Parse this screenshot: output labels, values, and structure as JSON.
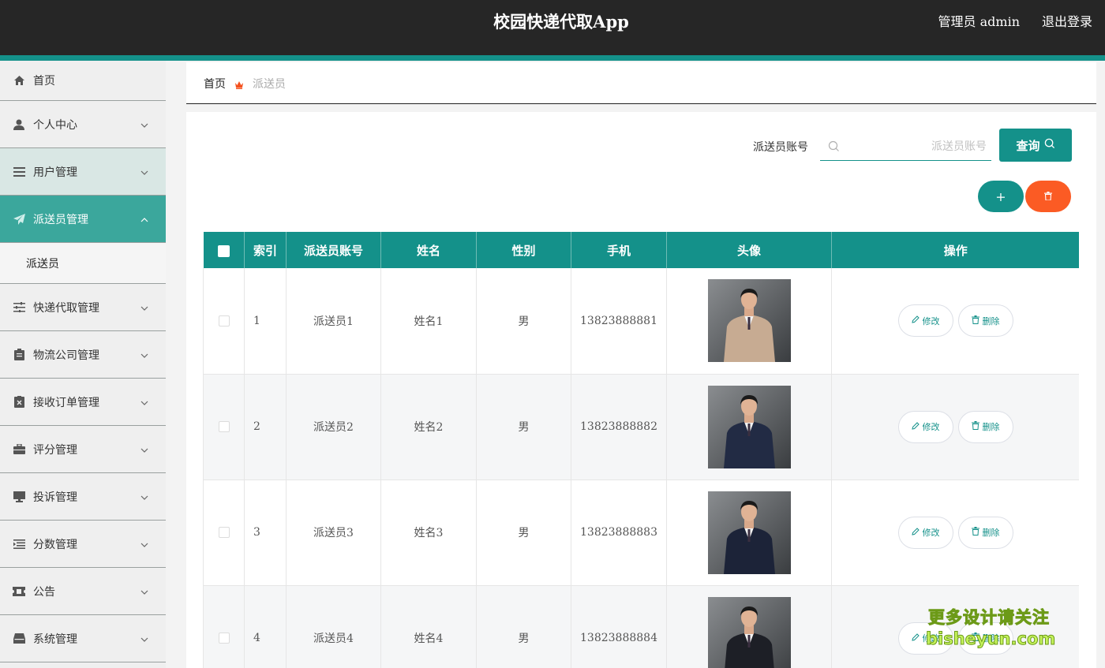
{
  "header": {
    "title": "校园快递代取App",
    "admin_label": "管理员 admin",
    "logout_label": "退出登录",
    "accent_color": "#14918a"
  },
  "sidebar": {
    "items": [
      {
        "label": "首页",
        "icon": "home-icon"
      },
      {
        "label": "个人中心",
        "icon": "user-icon"
      },
      {
        "label": "用户管理",
        "icon": "list-icon"
      },
      {
        "label": "派送员管理",
        "icon": "paper-plane-icon"
      },
      {
        "label": "快递代取管理",
        "icon": "sliders-icon"
      },
      {
        "label": "物流公司管理",
        "icon": "clipboard-icon"
      },
      {
        "label": "接收订单管理",
        "icon": "document-x-icon"
      },
      {
        "label": "评分管理",
        "icon": "briefcase-icon"
      },
      {
        "label": "投诉管理",
        "icon": "monitor-icon"
      },
      {
        "label": "分数管理",
        "icon": "indent-list-icon"
      },
      {
        "label": "公告",
        "icon": "ticket-icon"
      },
      {
        "label": "系统管理",
        "icon": "inbox-icon"
      }
    ],
    "sub_item": "派送员"
  },
  "breadcrumb": {
    "home": "首页",
    "current": "派送员"
  },
  "search": {
    "label": "派送员账号",
    "placeholder": "派送员账号",
    "value": "",
    "button": "查询"
  },
  "actions": {
    "add": "+"
  },
  "table": {
    "columns": [
      "索引",
      "派送员账号",
      "姓名",
      "性别",
      "手机",
      "头像",
      "操作"
    ],
    "edit_label": "修改",
    "delete_label": "删除",
    "rows": [
      {
        "index": "1",
        "account": "派送员1",
        "name": "姓名1",
        "gender": "男",
        "phone": "13823888881",
        "suit": "#c7ab92"
      },
      {
        "index": "2",
        "account": "派送员2",
        "name": "姓名2",
        "gender": "男",
        "phone": "13823888882",
        "suit": "#222b44"
      },
      {
        "index": "3",
        "account": "派送员3",
        "name": "姓名3",
        "gender": "男",
        "phone": "13823888883",
        "suit": "#1c2338"
      },
      {
        "index": "4",
        "account": "派送员4",
        "name": "姓名4",
        "gender": "男",
        "phone": "13823888884",
        "suit": "#1d1f26"
      }
    ]
  },
  "watermark": {
    "line1": "更多设计请关注",
    "line2": "bisheyun.com"
  }
}
